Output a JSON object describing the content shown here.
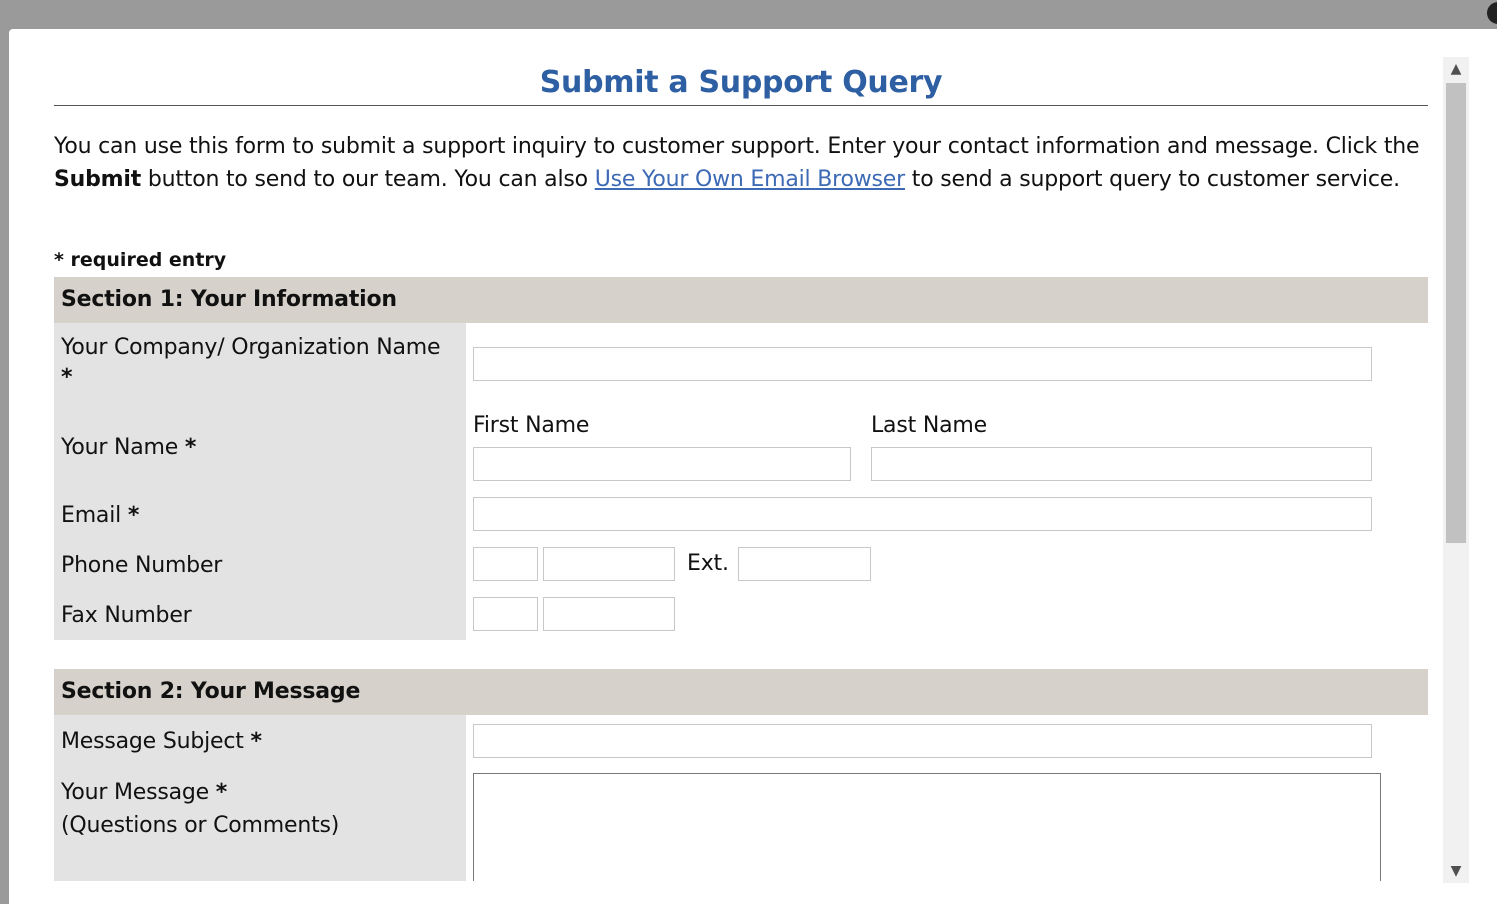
{
  "page": {
    "title": "Submit a Support Query",
    "intro_part1": "You can use this form to submit a support inquiry to customer support. Enter your contact information and message. Click the ",
    "intro_bold": "Submit",
    "intro_part2": " button to send to our team. You can also ",
    "intro_link": "Use Your Own Email Browser",
    "intro_part3": " to send a support query to customer service.",
    "required_note": "* required entry"
  },
  "section1": {
    "header": "Section 1: Your Information",
    "company_label": "Your Company/ Organization Name",
    "company_value": "",
    "name_label": "Your Name",
    "first_name_label": "First Name",
    "last_name_label": "Last Name",
    "first_name_value": "",
    "last_name_value": "",
    "email_label": "Email",
    "email_value": "",
    "phone_label": "Phone Number",
    "phone_area_value": "",
    "phone_number_value": "",
    "ext_label": "Ext.",
    "ext_value": "",
    "fax_label": "Fax Number",
    "fax_area_value": "",
    "fax_number_value": "",
    "required_marker": "*"
  },
  "section2": {
    "header": "Section 2: Your Message",
    "subject_label": "Message Subject",
    "subject_value": "",
    "message_label": "Your Message",
    "message_sublabel": "(Questions or Comments)",
    "message_value": "",
    "required_marker": "*"
  },
  "scrollbar": {
    "up_icon": "▲",
    "down_icon": "▼"
  }
}
